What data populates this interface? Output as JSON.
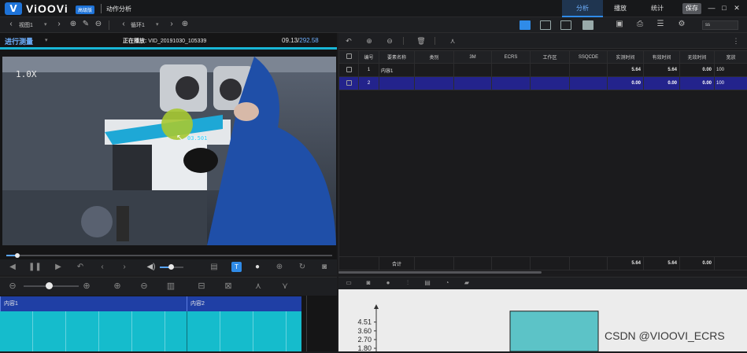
{
  "app": {
    "logo_letter": "V",
    "brand": "ViOOVi",
    "edition": "高级版",
    "page_title": "动作分析",
    "nav": {
      "analyze": "分析",
      "play": "播放",
      "stats": "统计"
    },
    "save_label": "保存",
    "window": {
      "min": "—",
      "max": "□",
      "close": "✕"
    }
  },
  "toolbar": {
    "view_select": "视图1",
    "cycle_select": "循环1",
    "speed_value": "ss"
  },
  "video_panel": {
    "title": "进行测量",
    "now_playing_label": "正在播放:",
    "file_name": "VID_20191030_105339",
    "time_current": "09.13/",
    "time_total": "292.58",
    "zoom": "1.0X",
    "overlay_tag": "03.501",
    "seek_fraction": 0.035,
    "volume_fraction": 0.45
  },
  "table": {
    "columns": [
      "编号",
      "要素名称",
      "类别",
      "3M",
      "ECRS",
      "工作区",
      "SSQCDE",
      "实测时间",
      "有效时间",
      "无效时间",
      "宽放"
    ],
    "rows": [
      {
        "id": "1",
        "name": "内容1",
        "category": "",
        "m3": "",
        "ecrs": "",
        "area": "",
        "ssqcde": "",
        "measured": "5.64",
        "effective": "5.64",
        "invalid": "0.00",
        "allowance": "100",
        "selected": false
      },
      {
        "id": "2",
        "name": "",
        "category": "",
        "m3": "",
        "ecrs": "",
        "area": "",
        "ssqcde": "",
        "measured": "0.00",
        "effective": "0.00",
        "invalid": "0.00",
        "allowance": "100",
        "selected": true
      }
    ],
    "totals": {
      "label": "合计",
      "measured": "5.64",
      "effective": "5.64",
      "invalid": "0.00"
    }
  },
  "timeline": {
    "segments": [
      {
        "label": "内容1"
      },
      {
        "label": "内容2"
      }
    ],
    "zoom_fraction": 0.45
  },
  "chart_data": {
    "type": "bar",
    "y_ticks": [
      "4.51",
      "3.60",
      "2.70",
      "1.80"
    ],
    "values": [
      5.64
    ]
  },
  "watermark": "CSDN @VIOOVI_ECRS",
  "colors": {
    "accent": "#2f8be8",
    "teal": "#15bccc",
    "selected_row": "#23238c"
  }
}
